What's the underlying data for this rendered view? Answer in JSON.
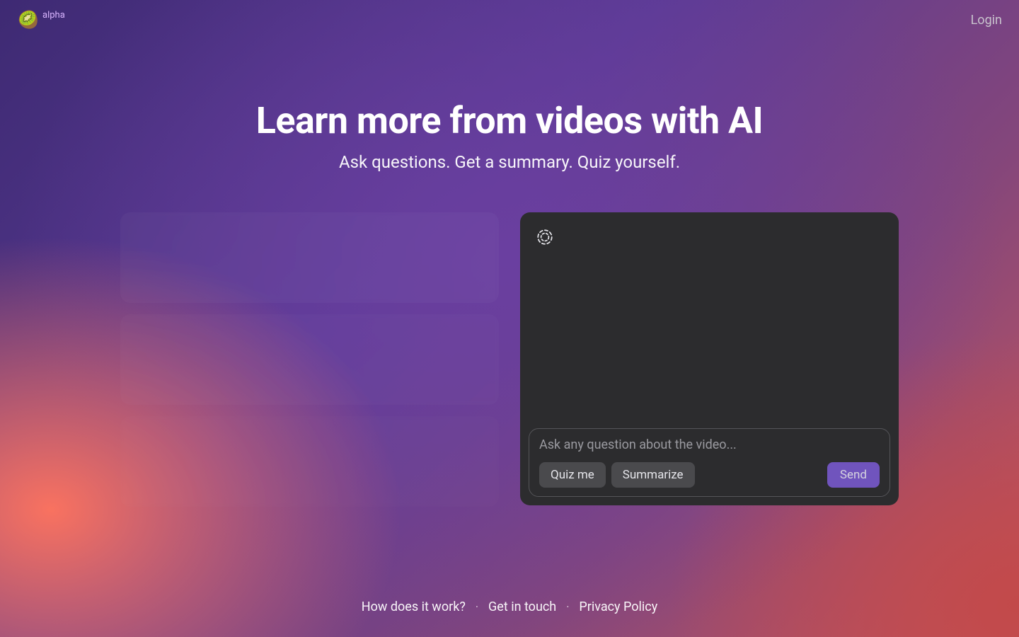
{
  "header": {
    "brand_tag": "alpha",
    "brand_emoji": "🥝",
    "login_label": "Login"
  },
  "hero": {
    "title": "Learn more from videos with AI",
    "subtitle": "Ask questions. Get a summary. Quiz yourself."
  },
  "composer": {
    "placeholder": "Ask any question about the video...",
    "quiz_label": "Quiz me",
    "summarize_label": "Summarize",
    "send_label": "Send"
  },
  "footer": {
    "how_label": "How does it work?",
    "contact_label": "Get in touch",
    "privacy_label": "Privacy Policy",
    "separator": "·"
  },
  "colors": {
    "accent": "#7c5bd6",
    "panel": "#2c2c2e",
    "chip": "#4a4a4d"
  }
}
